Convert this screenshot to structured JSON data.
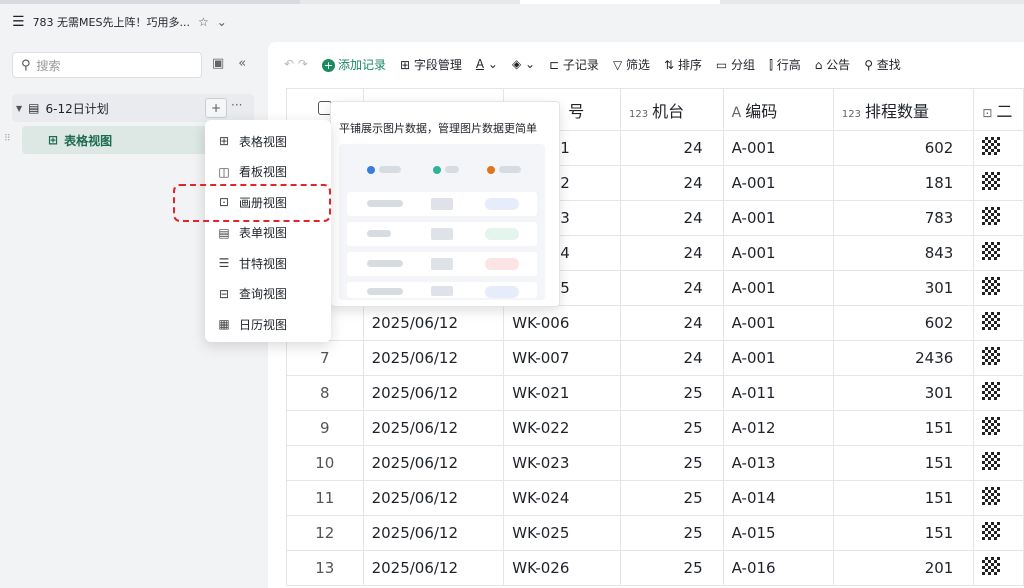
{
  "app": {
    "title": "783 无需MES先上阵！巧用多...",
    "star_icon": "star-icon"
  },
  "sidebar": {
    "search_placeholder": "搜索",
    "folder": {
      "label": "6-12日计划"
    },
    "view": {
      "label": "表格视图"
    }
  },
  "toolbar": {
    "add": "添加记录",
    "fields": "字段管理",
    "subrecord": "子记录",
    "filter": "筛选",
    "sort": "排序",
    "group": "分组",
    "rowheight": "行高",
    "notice": "公告",
    "find": "查找"
  },
  "table": {
    "headers": [
      "",
      "",
      "号",
      "机台",
      "编码",
      "排程数量",
      "二"
    ],
    "rows": [
      {
        "idx": "",
        "date": "",
        "wk": "1",
        "machine": "24",
        "code": "A-001",
        "qty": "602"
      },
      {
        "idx": "",
        "date": "",
        "wk": "2",
        "machine": "24",
        "code": "A-001",
        "qty": "181"
      },
      {
        "idx": "",
        "date": "",
        "wk": "3",
        "machine": "24",
        "code": "A-001",
        "qty": "783"
      },
      {
        "idx": "",
        "date": "",
        "wk": "4",
        "machine": "24",
        "code": "A-001",
        "qty": "843"
      },
      {
        "idx": "",
        "date": "",
        "wk": "5",
        "machine": "24",
        "code": "A-001",
        "qty": "301"
      },
      {
        "idx": "",
        "date": "2025/06/12",
        "wk": "WK-006",
        "machine": "24",
        "code": "A-001",
        "qty": "602"
      },
      {
        "idx": "7",
        "date": "2025/06/12",
        "wk": "WK-007",
        "machine": "24",
        "code": "A-001",
        "qty": "2436"
      },
      {
        "idx": "8",
        "date": "2025/06/12",
        "wk": "WK-021",
        "machine": "25",
        "code": "A-011",
        "qty": "301"
      },
      {
        "idx": "9",
        "date": "2025/06/12",
        "wk": "WK-022",
        "machine": "25",
        "code": "A-012",
        "qty": "151"
      },
      {
        "idx": "10",
        "date": "2025/06/12",
        "wk": "WK-023",
        "machine": "25",
        "code": "A-013",
        "qty": "151"
      },
      {
        "idx": "11",
        "date": "2025/06/12",
        "wk": "WK-024",
        "machine": "25",
        "code": "A-014",
        "qty": "151"
      },
      {
        "idx": "12",
        "date": "2025/06/12",
        "wk": "WK-025",
        "machine": "25",
        "code": "A-015",
        "qty": "151"
      },
      {
        "idx": "13",
        "date": "2025/06/12",
        "wk": "WK-026",
        "machine": "25",
        "code": "A-016",
        "qty": "201"
      }
    ]
  },
  "view_menu": {
    "items": [
      "表格视图",
      "看板视图",
      "画册视图",
      "表单视图",
      "甘特视图",
      "查询视图",
      "日历视图"
    ],
    "highlighted": "画册视图"
  },
  "preview": {
    "text": "平铺展示图片数据，管理图片数据更简单"
  }
}
